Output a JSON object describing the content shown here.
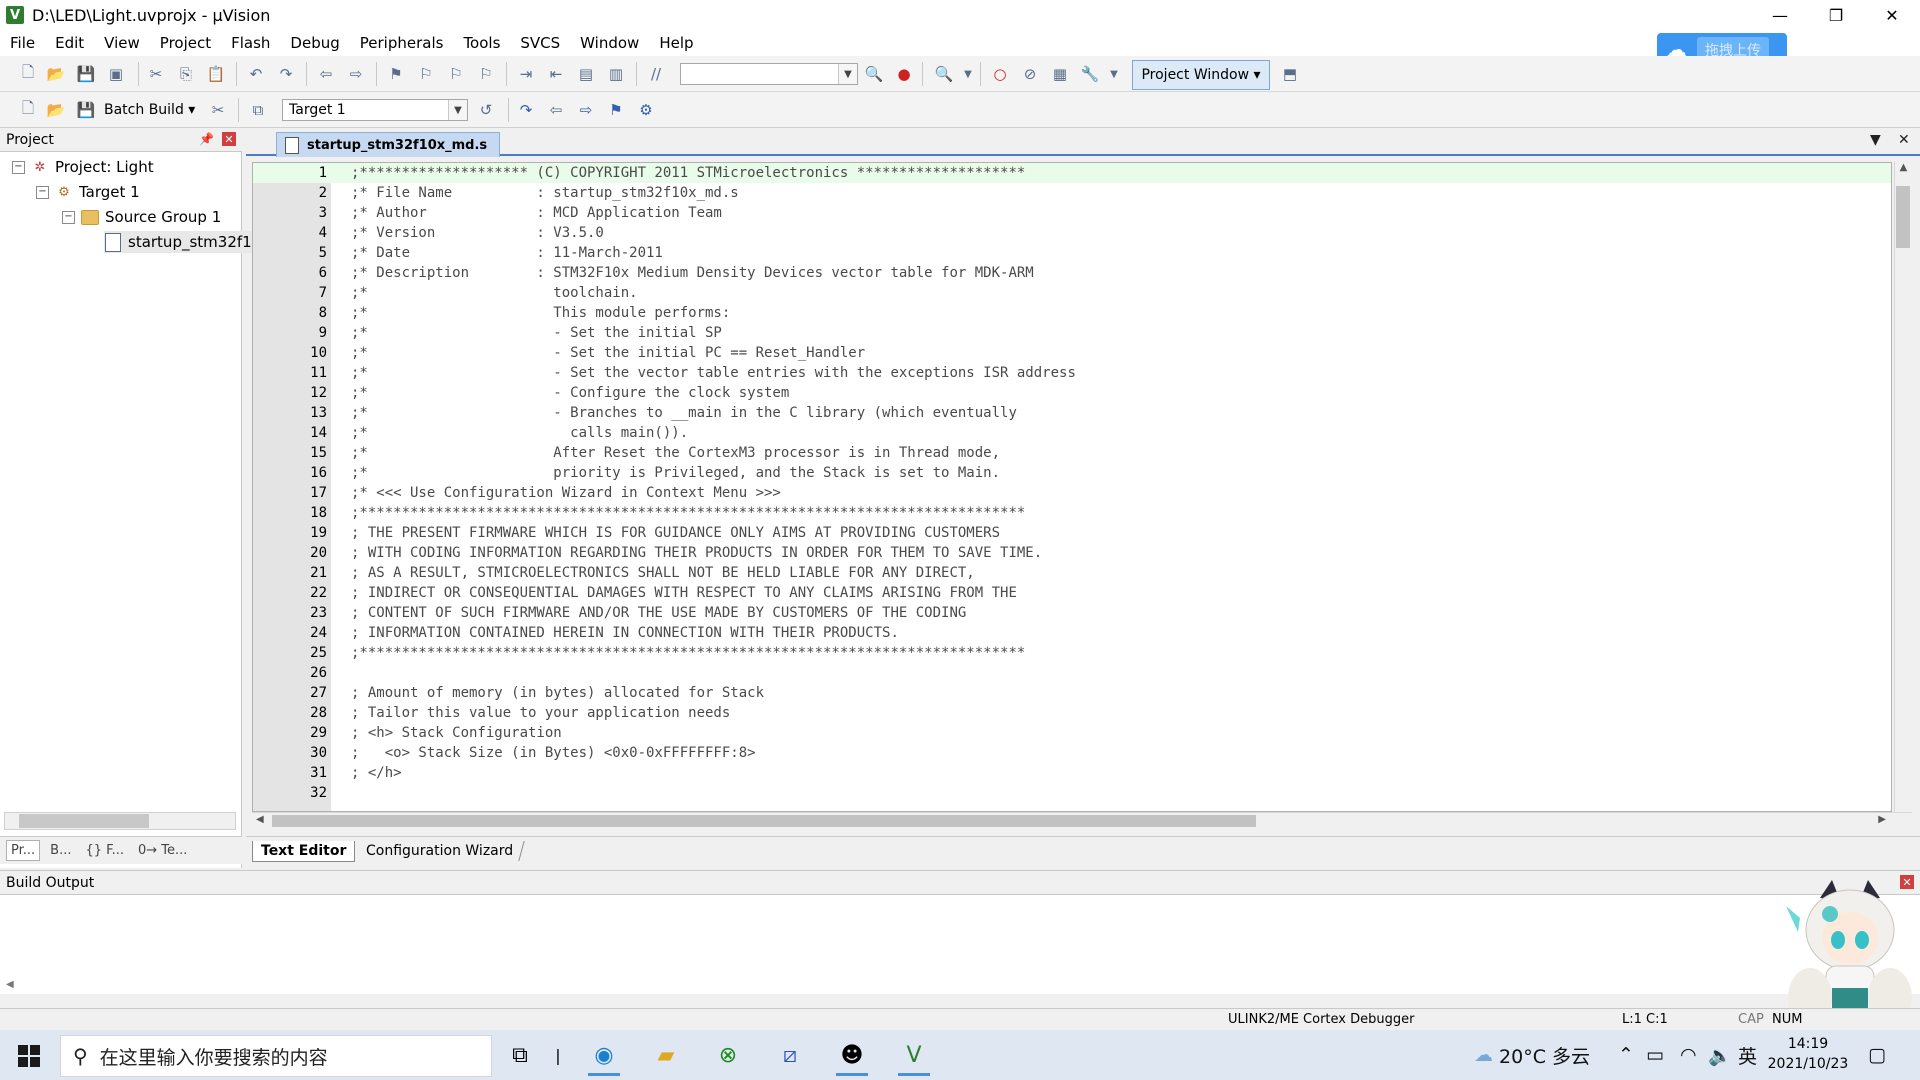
{
  "window": {
    "title": "D:\\LED\\Light.uvprojx - µVision",
    "minimize": "—",
    "restore": "❐",
    "close": "✕"
  },
  "menu": [
    "File",
    "Edit",
    "View",
    "Project",
    "Flash",
    "Debug",
    "Peripherals",
    "Tools",
    "SVCS",
    "Window",
    "Help"
  ],
  "cloud_upload": {
    "label": "拖拽上传",
    "color": "#3a96f0"
  },
  "toolbar": {
    "project_window": "Project Window",
    "batch_build": "Batch Build",
    "target_select": "Target 1"
  },
  "project_panel": {
    "title": "Project",
    "tree": {
      "project": "Project: Light",
      "target": "Target 1",
      "group": "Source Group 1",
      "file": "startup_stm32f1"
    },
    "tabs": [
      "Pr...",
      "B...",
      "{} F...",
      "0→ Te..."
    ]
  },
  "editor": {
    "tab": "startup_stm32f10x_md.s",
    "lines": [
      {
        "n": "1",
        "t": ";******************** (C) COPYRIGHT 2011 STMicroelectronics ********************"
      },
      {
        "n": "2",
        "t": ";* File Name          : startup_stm32f10x_md.s"
      },
      {
        "n": "3",
        "t": ";* Author             : MCD Application Team"
      },
      {
        "n": "4",
        "t": ";* Version            : V3.5.0"
      },
      {
        "n": "5",
        "t": ";* Date               : 11-March-2011"
      },
      {
        "n": "6",
        "t": ";* Description        : STM32F10x Medium Density Devices vector table for MDK-ARM"
      },
      {
        "n": "7",
        "t": ";*                      toolchain."
      },
      {
        "n": "8",
        "t": ";*                      This module performs:"
      },
      {
        "n": "9",
        "t": ";*                      - Set the initial SP"
      },
      {
        "n": "10",
        "t": ";*                      - Set the initial PC == Reset_Handler"
      },
      {
        "n": "11",
        "t": ";*                      - Set the vector table entries with the exceptions ISR address"
      },
      {
        "n": "12",
        "t": ";*                      - Configure the clock system"
      },
      {
        "n": "13",
        "t": ";*                      - Branches to __main in the C library (which eventually"
      },
      {
        "n": "14",
        "t": ";*                        calls main())."
      },
      {
        "n": "15",
        "t": ";*                      After Reset the CortexM3 processor is in Thread mode,"
      },
      {
        "n": "16",
        "t": ";*                      priority is Privileged, and the Stack is set to Main."
      },
      {
        "n": "17",
        "t": ";* <<< Use Configuration Wizard in Context Menu >>>"
      },
      {
        "n": "18",
        "t": ";*******************************************************************************"
      },
      {
        "n": "19",
        "t": "; THE PRESENT FIRMWARE WHICH IS FOR GUIDANCE ONLY AIMS AT PROVIDING CUSTOMERS"
      },
      {
        "n": "20",
        "t": "; WITH CODING INFORMATION REGARDING THEIR PRODUCTS IN ORDER FOR THEM TO SAVE TIME."
      },
      {
        "n": "21",
        "t": "; AS A RESULT, STMICROELECTRONICS SHALL NOT BE HELD LIABLE FOR ANY DIRECT,"
      },
      {
        "n": "22",
        "t": "; INDIRECT OR CONSEQUENTIAL DAMAGES WITH RESPECT TO ANY CLAIMS ARISING FROM THE"
      },
      {
        "n": "23",
        "t": "; CONTENT OF SUCH FIRMWARE AND/OR THE USE MADE BY CUSTOMERS OF THE CODING"
      },
      {
        "n": "24",
        "t": "; INFORMATION CONTAINED HEREIN IN CONNECTION WITH THEIR PRODUCTS."
      },
      {
        "n": "25",
        "t": ";*******************************************************************************"
      },
      {
        "n": "26",
        "t": ""
      },
      {
        "n": "27",
        "t": "; Amount of memory (in bytes) allocated for Stack"
      },
      {
        "n": "28",
        "t": "; Tailor this value to your application needs"
      },
      {
        "n": "29",
        "t": "; <h> Stack Configuration"
      },
      {
        "n": "30",
        "t": ";   <o> Stack Size (in Bytes) <0x0-0xFFFFFFFF:8>"
      },
      {
        "n": "31",
        "t": "; </h>"
      },
      {
        "n": "32",
        "t": ""
      }
    ],
    "bottom_tabs": [
      "Text Editor",
      "Configuration Wizard"
    ]
  },
  "build_output": {
    "title": "Build Output"
  },
  "status": {
    "debugger": "ULINK2/ME Cortex Debugger",
    "position": "L:1 C:1",
    "cap": "CAP",
    "num": "NUM"
  },
  "taskbar": {
    "search_placeholder": "在这里输入你要搜索的内容",
    "weather": "20°C 多云",
    "ime": "英",
    "time": "14:19",
    "date": "2021/10/23"
  }
}
